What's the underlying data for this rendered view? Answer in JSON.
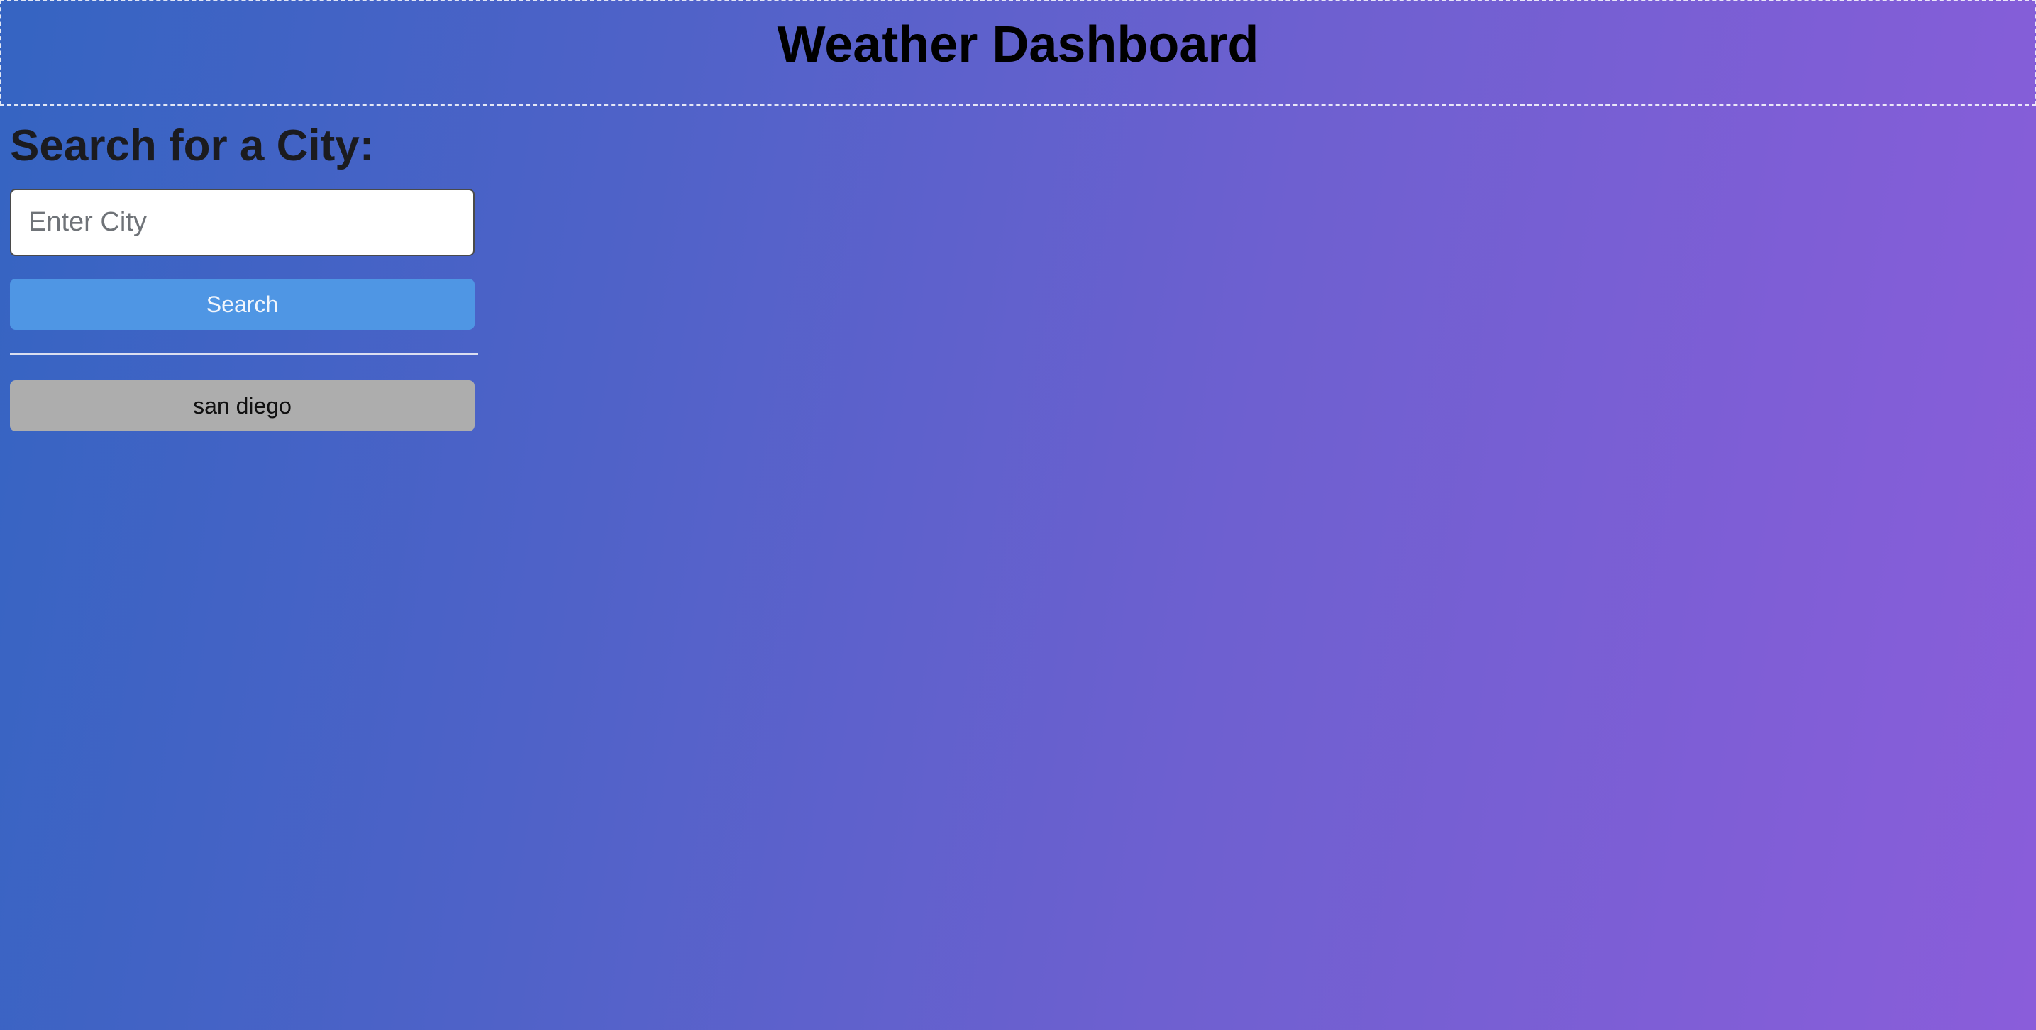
{
  "header": {
    "title": "Weather Dashboard"
  },
  "search": {
    "heading": "Search for a City:",
    "placeholder": "Enter City",
    "value": "",
    "button_label": "Search"
  },
  "history": {
    "items": [
      {
        "label": "san diego"
      }
    ]
  },
  "colors": {
    "gradient_start": "#3564c2",
    "gradient_end": "#8a5dda",
    "search_button": "#4f96e4",
    "history_button": "#adadad"
  }
}
